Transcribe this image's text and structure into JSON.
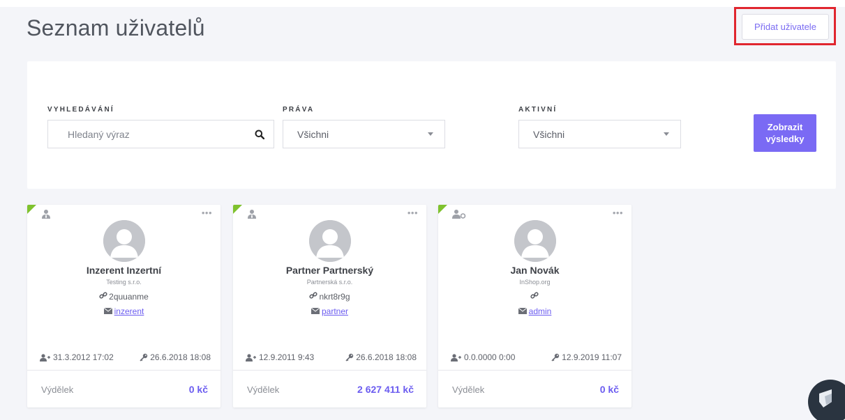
{
  "header": {
    "title": "Seznam uživatelů",
    "add_user_label": "Přidat uživatele"
  },
  "filters": {
    "search_label": "VYHLEDÁVÁNÍ",
    "search_placeholder": "Hledaný výraz",
    "rights_label": "PRÁVA",
    "rights_value": "Všichni",
    "active_label": "AKTIVNÍ",
    "active_value": "Všichni",
    "show_results_line1": "Zobrazit",
    "show_results_line2": "výsledky"
  },
  "colors": {
    "accent": "#7a6af4",
    "highlight": "#e0262f",
    "active_corner": "#7fc22e"
  },
  "users": [
    {
      "role_icon": "user-tie-icon",
      "name": "Inzerent Inzertní",
      "company": "Testing s.r.o.",
      "code": "2quuanme",
      "login": "inzerent",
      "created": "31.3.2012 17:02",
      "last_login": "26.6.2018 18:08",
      "earnings_label": "Výdělek",
      "earnings": "0 kč"
    },
    {
      "role_icon": "user-tie-icon",
      "name": "Partner Partnerský",
      "company": "Partnerská s.r.o.",
      "code": "nkrt8r9g",
      "login": "partner",
      "created": "12.9.2011 9:43",
      "last_login": "26.6.2018 18:08",
      "earnings_label": "Výdělek",
      "earnings": "2 627 411 kč"
    },
    {
      "role_icon": "user-admin-icon",
      "name": "Jan Novák",
      "company": "InShop.org",
      "code": "",
      "login": "admin",
      "created": "0.0.0000 0:00",
      "last_login": "12.9.2019 11:07",
      "earnings_label": "Výdělek",
      "earnings": "0 kč"
    }
  ]
}
